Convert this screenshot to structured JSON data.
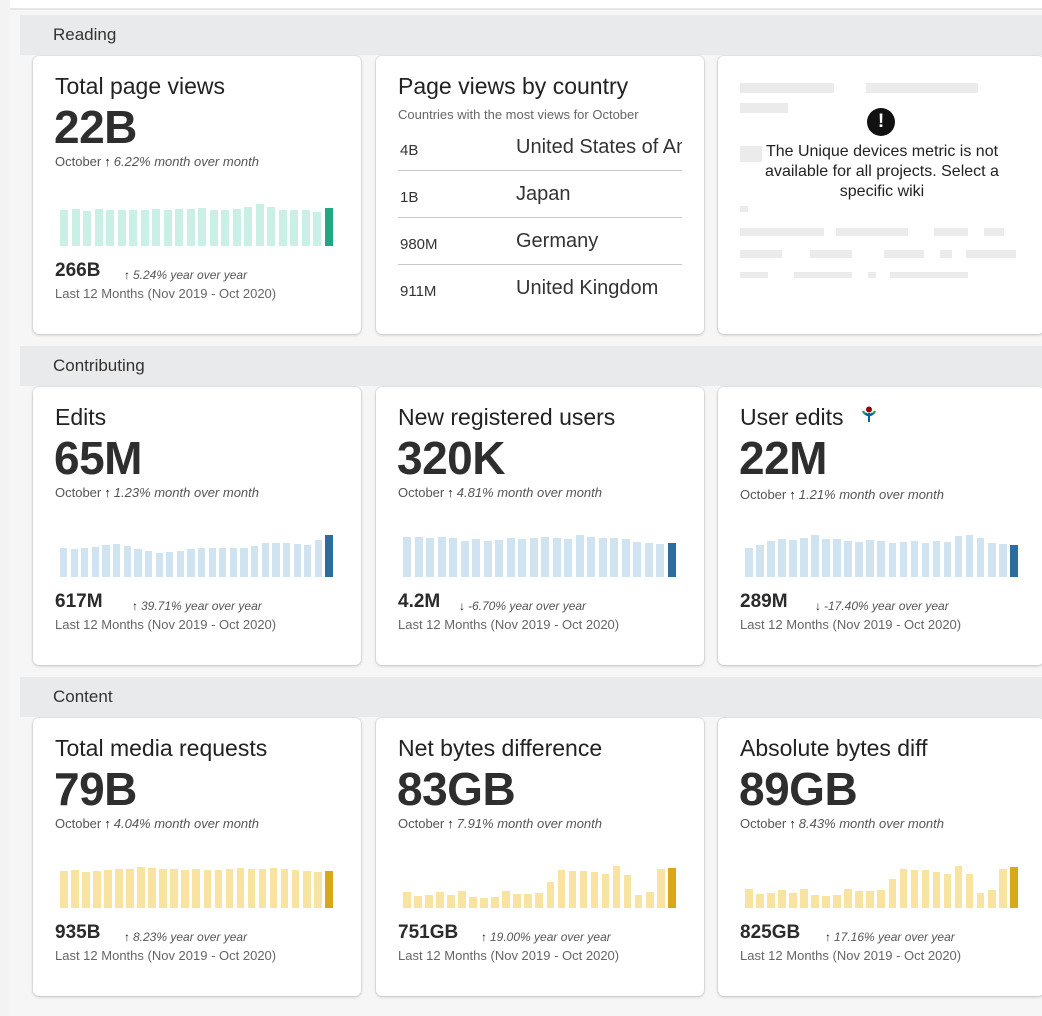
{
  "sections": {
    "reading": "Reading",
    "contributing": "Contributing",
    "content": "Content"
  },
  "colors": {
    "reading_bar": "#c9efe6",
    "reading_bar_current": "#21a883",
    "contrib_bar": "#cfe3f0",
    "contrib_bar_current": "#2a6d9e",
    "content_bar": "#f9e3a1",
    "content_bar_current": "#d8a818"
  },
  "cards": {
    "total_page_views": {
      "title": "Total page views",
      "value": "22B",
      "month": "October",
      "arrow": "↑",
      "mom": "6.22% month over month",
      "total": "266B",
      "yoy_arrow": "↑",
      "yoy": "5.24% year over year",
      "range": "Last 12 Months (Nov 2019 - Oct 2020)",
      "bars": [
        0.86,
        0.88,
        0.84,
        0.87,
        0.86,
        0.86,
        0.85,
        0.86,
        0.88,
        0.86,
        0.87,
        0.88,
        0.9,
        0.86,
        0.86,
        0.88,
        0.93,
        1.0,
        0.93,
        0.86,
        0.86,
        0.85,
        0.82,
        0.9
      ]
    },
    "page_views_by_country": {
      "title": "Page views by country",
      "subtitle": "Countries with the most views for October",
      "rows": [
        {
          "value": "4B",
          "country": "United States of America"
        },
        {
          "value": "1B",
          "country": "Japan"
        },
        {
          "value": "980M",
          "country": "Germany"
        },
        {
          "value": "911M",
          "country": "United Kingdom"
        }
      ]
    },
    "unique_devices": {
      "icon": "!",
      "message": "The Unique devices metric is not available for all projects. Select a specific wiki"
    },
    "edits": {
      "title": "Edits",
      "value": "65M",
      "month": "October",
      "arrow": "↑",
      "mom": "1.23% month over month",
      "total": "617M",
      "yoy_arrow": "↑",
      "yoy": "39.71% year over year",
      "range": "Last 12 Months (Nov 2019 - Oct 2020)",
      "bars": [
        0.68,
        0.66,
        0.68,
        0.72,
        0.76,
        0.78,
        0.73,
        0.66,
        0.62,
        0.58,
        0.6,
        0.62,
        0.66,
        0.68,
        0.7,
        0.7,
        0.68,
        0.7,
        0.73,
        0.8,
        0.82,
        0.8,
        0.78,
        0.76,
        0.88,
        1.0
      ]
    },
    "new_registered_users": {
      "title": "New registered users",
      "value": "320K",
      "month": "October",
      "arrow": "↑",
      "mom": "4.81% month over month",
      "total": "4.2M",
      "yoy_arrow": "↓",
      "yoy": "-6.70% year over year",
      "range": "Last 12 Months (Nov 2019 - Oct 2020)",
      "bars": [
        0.96,
        0.96,
        0.94,
        0.96,
        0.92,
        0.86,
        0.9,
        0.86,
        0.88,
        0.92,
        0.9,
        0.94,
        0.96,
        0.92,
        0.9,
        1.0,
        0.96,
        0.94,
        0.92,
        0.9,
        0.84,
        0.82,
        0.78,
        0.8
      ]
    },
    "user_edits": {
      "title": "User edits",
      "value": "22M",
      "month": "October",
      "arrow": "↑",
      "mom": "1.21% month over month",
      "total": "289M",
      "yoy_arrow": "↓",
      "yoy": "-17.40% year over year",
      "range": "Last 12 Months (Nov 2019 - Oct 2020)",
      "bars": [
        0.7,
        0.76,
        0.86,
        0.9,
        0.88,
        0.92,
        1.0,
        0.9,
        0.9,
        0.86,
        0.84,
        0.88,
        0.86,
        0.82,
        0.84,
        0.86,
        0.82,
        0.86,
        0.84,
        0.98,
        1.0,
        0.94,
        0.8,
        0.78,
        0.76
      ]
    },
    "total_media_requests": {
      "title": "Total media requests",
      "value": "79B",
      "month": "October",
      "arrow": "↑",
      "mom": "4.04% month over month",
      "total": "935B",
      "yoy_arrow": "↑",
      "yoy": "8.23% year over year",
      "range": "Last 12 Months (Nov 2019 - Oct 2020)",
      "bars": [
        0.88,
        0.9,
        0.86,
        0.88,
        0.9,
        0.92,
        0.94,
        0.98,
        0.96,
        0.94,
        0.92,
        0.9,
        0.94,
        0.9,
        0.9,
        0.94,
        0.96,
        0.92,
        0.94,
        0.96,
        0.92,
        0.9,
        0.88,
        0.86,
        0.88
      ]
    },
    "net_bytes_difference": {
      "title": "Net bytes difference",
      "value": "83GB",
      "month": "October",
      "arrow": "↑",
      "mom": "7.91% month over month",
      "total": "751GB",
      "yoy_arrow": "↑",
      "yoy": "19.00% year over year",
      "range": "Last 12 Months (Nov 2019 - Oct 2020)",
      "bars": [
        0.38,
        0.28,
        0.3,
        0.38,
        0.3,
        0.4,
        0.26,
        0.24,
        0.26,
        0.4,
        0.34,
        0.34,
        0.36,
        0.62,
        0.9,
        0.88,
        0.88,
        0.86,
        0.82,
        1.0,
        0.78,
        0.32,
        0.38,
        0.92,
        0.96
      ]
    },
    "absolute_bytes_diff": {
      "title": "Absolute bytes diff",
      "value": "89GB",
      "month": "October",
      "arrow": "↑",
      "mom": "8.43% month over month",
      "total": "825GB",
      "yoy_arrow": "↑",
      "yoy": "17.16% year over year",
      "range": "Last 12 Months (Nov 2019 - Oct 2020)",
      "bars": [
        0.46,
        0.34,
        0.36,
        0.44,
        0.36,
        0.46,
        0.3,
        0.28,
        0.32,
        0.46,
        0.4,
        0.4,
        0.42,
        0.68,
        0.92,
        0.9,
        0.9,
        0.86,
        0.82,
        1.0,
        0.82,
        0.36,
        0.42,
        0.94,
        0.98
      ]
    }
  }
}
